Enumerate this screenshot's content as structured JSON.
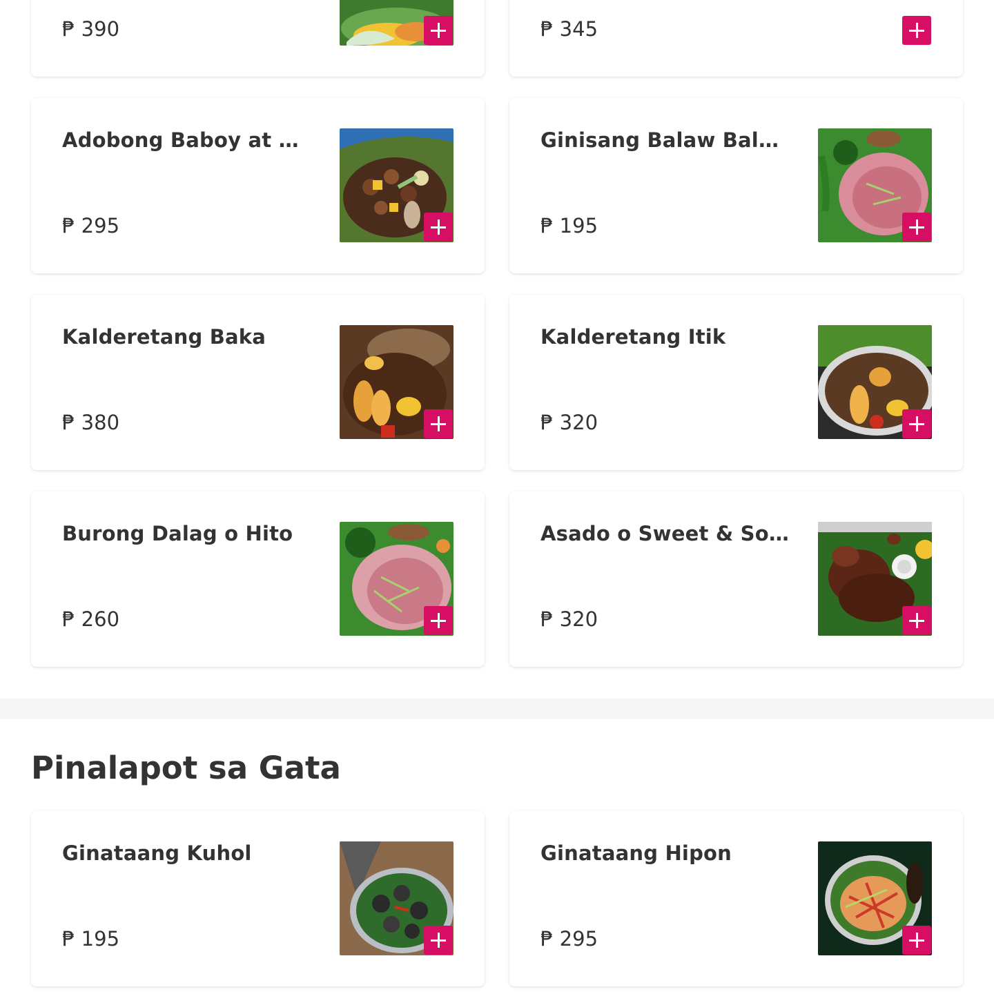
{
  "currency": "₱",
  "accent_color": "#d70f64",
  "top_cards": [
    {
      "price": "₱ 390",
      "has_photo": true
    },
    {
      "price": "₱ 345",
      "has_photo": false
    }
  ],
  "items": [
    {
      "name": "Adobong Baboy at Ma...",
      "price": "₱ 295"
    },
    {
      "name": "Ginisang Balaw Balaw ...",
      "price": "₱ 195"
    },
    {
      "name": "Kalderetang Baka",
      "price": "₱ 380"
    },
    {
      "name": "Kalderetang Itik",
      "price": "₱ 320"
    },
    {
      "name": "Burong Dalag o Hito",
      "price": "₱ 260"
    },
    {
      "name": "Asado o Sweet & Sour I...",
      "price": "₱ 320"
    }
  ],
  "section": {
    "title": "Pinalapot sa Gata",
    "items": [
      {
        "name": "Ginataang Kuhol",
        "price": "₱ 195"
      },
      {
        "name": "Ginataang Hipon",
        "price": "₱ 295"
      }
    ]
  },
  "icons": {
    "add": "plus-icon"
  }
}
